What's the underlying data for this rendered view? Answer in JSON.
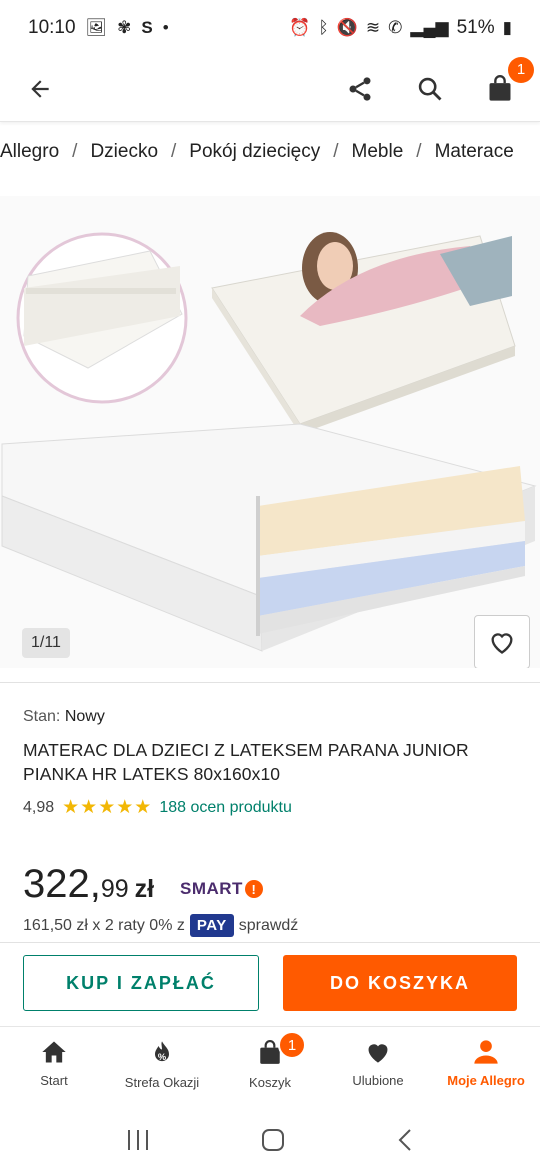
{
  "status_bar": {
    "time": "10:10",
    "battery": "51%",
    "left_icons": [
      "image-icon",
      "pinwheel-icon",
      "s-icon",
      "dot-icon"
    ],
    "right_icons": [
      "alarm-icon",
      "bluetooth-icon",
      "mute-icon",
      "wifi-icon",
      "call-icon",
      "signal-icon",
      "battery-icon"
    ]
  },
  "appbar": {
    "cart_count": "1"
  },
  "breadcrumb": {
    "items": [
      "Allegro",
      "Dziecko",
      "Pokój dziecięcy",
      "Meble",
      "Materace"
    ],
    "separator": "/"
  },
  "gallery": {
    "counter": "1/11"
  },
  "product": {
    "condition_label": "Stan:",
    "condition_value": "Nowy",
    "title": "MATERAC DLA DZIECI Z LATEKSEM PARANA JUNIOR PIANKA HR LATEKS 80x160x10",
    "rating_score": "4,98",
    "stars": "★★★★★",
    "rating_count": "188 ocen produktu"
  },
  "price": {
    "integer": "322,",
    "decimal": "99",
    "currency": "zł",
    "smart_label": "SMART",
    "smart_mark": "!",
    "installments_text": "161,50 zł x 2 raty 0% z",
    "pay_label": "PAY",
    "check_label": "sprawdź"
  },
  "actions": {
    "buy_now": "KUP I ZAPŁAĆ",
    "add_to_cart": "DO KOSZYKA"
  },
  "bottom_nav": {
    "items": [
      {
        "label": "Start",
        "icon": "home-icon"
      },
      {
        "label": "Strefa Okazji",
        "icon": "deals-icon"
      },
      {
        "label": "Koszyk",
        "icon": "bag-icon",
        "badge": "1"
      },
      {
        "label": "Ulubione",
        "icon": "heart-icon"
      },
      {
        "label": "Moje Allegro",
        "icon": "user-icon",
        "active": true
      }
    ]
  },
  "colors": {
    "accent": "#ff5a00",
    "green": "#00806b",
    "smart_purple": "#4b2c6d",
    "pay_blue": "#21398f",
    "star": "#f2b705"
  }
}
